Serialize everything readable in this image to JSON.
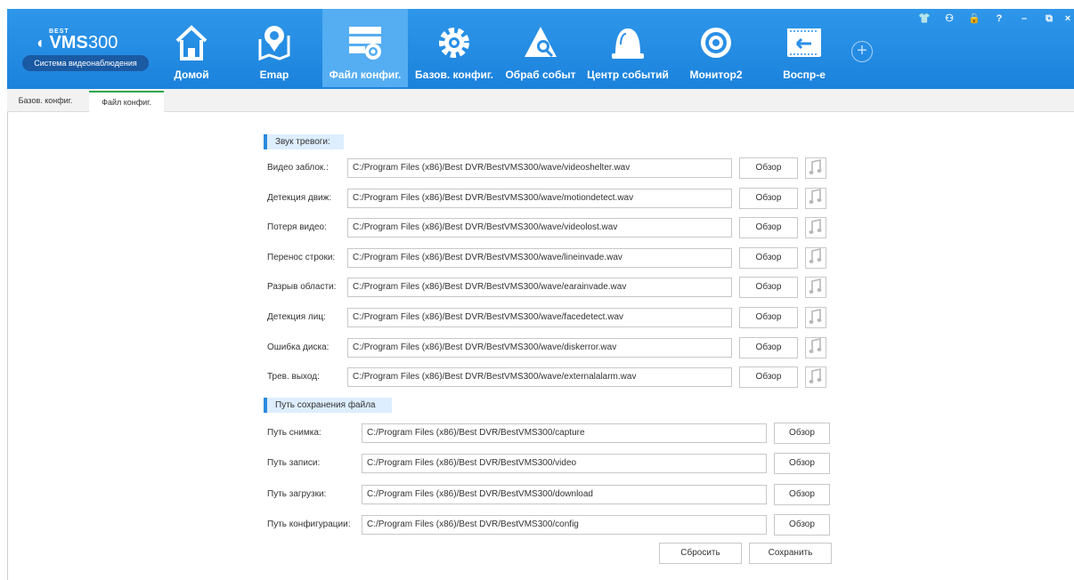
{
  "logo": {
    "brand": "BEST",
    "mark": "VMS",
    "number": "300",
    "subtitle": "Система видеонаблюдения"
  },
  "nav": [
    {
      "label": "Домой",
      "icon": "home-icon"
    },
    {
      "label": "Emap",
      "icon": "map-pin-icon"
    },
    {
      "label": "Файл конфиг.",
      "icon": "file-config-icon",
      "active": true
    },
    {
      "label": "Базов. конфиг.",
      "icon": "gear-icon"
    },
    {
      "label": "Обраб событ",
      "icon": "alert-search-icon"
    },
    {
      "label": "Центр событий",
      "icon": "alarm-bell-icon"
    },
    {
      "label": "Монитор2",
      "icon": "monitor-eye-icon"
    },
    {
      "label": "Воспр-е",
      "icon": "playback-icon"
    }
  ],
  "window_controls": [
    "shirt-icon",
    "user-icon",
    "lock-icon",
    "help-icon",
    "minimize-icon",
    "restore-icon",
    "close-icon"
  ],
  "window_controls_glyphs": [
    "👕",
    "⚇",
    "🔒",
    "?",
    "–",
    "⧉",
    "×"
  ],
  "tabs": [
    {
      "label": "Базов. конфиг."
    },
    {
      "label": "Файл конфиг.",
      "active": true
    }
  ],
  "alarm_section": {
    "title": "Звук тревоги:",
    "browse_label": "Обзор",
    "rows": [
      {
        "label": "Видео заблок.:",
        "value": "C:/Program Files (x86)/Best DVR/BestVMS300/wave/videoshelter.wav"
      },
      {
        "label": "Детекция движ:",
        "value": "C:/Program Files (x86)/Best DVR/BestVMS300/wave/motiondetect.wav"
      },
      {
        "label": "Потеря видео:",
        "value": "C:/Program Files (x86)/Best DVR/BestVMS300/wave/videolost.wav"
      },
      {
        "label": "Перенос строки:",
        "value": "C:/Program Files (x86)/Best DVR/BestVMS300/wave/lineinvade.wav"
      },
      {
        "label": "Разрыв области:",
        "value": "C:/Program Files (x86)/Best DVR/BestVMS300/wave/earainvade.wav"
      },
      {
        "label": "Детекция лиц:",
        "value": "C:/Program Files (x86)/Best DVR/BestVMS300/wave/facedetect.wav"
      },
      {
        "label": "Ошибка диска:",
        "value": "C:/Program Files (x86)/Best DVR/BestVMS300/wave/diskerror.wav"
      },
      {
        "label": "Трев. выход:",
        "value": "C:/Program Files (x86)/Best DVR/BestVMS300/wave/externalalarm.wav"
      }
    ]
  },
  "path_section": {
    "title": "Путь сохранения файла",
    "browse_label": "Обзор",
    "rows": [
      {
        "label": "Путь снимка:",
        "value": "C:/Program Files (x86)/Best DVR/BestVMS300/capture"
      },
      {
        "label": "Путь записи:",
        "value": "C:/Program Files (x86)/Best DVR/BestVMS300/video"
      },
      {
        "label": "Путь загрузки:",
        "value": "C:/Program Files (x86)/Best DVR/BestVMS300/download"
      },
      {
        "label": "Путь конфигурации:",
        "value": "C:/Program Files (x86)/Best DVR/BestVMS300/config"
      }
    ]
  },
  "actions": {
    "reset_label": "Сбросить",
    "save_label": "Сохранить"
  },
  "colors": {
    "topbar": "#2a8fe6",
    "active_nav": "#55adf2",
    "active_tab_accent": "#2ea44a",
    "section_accent": "#2a8be0"
  }
}
